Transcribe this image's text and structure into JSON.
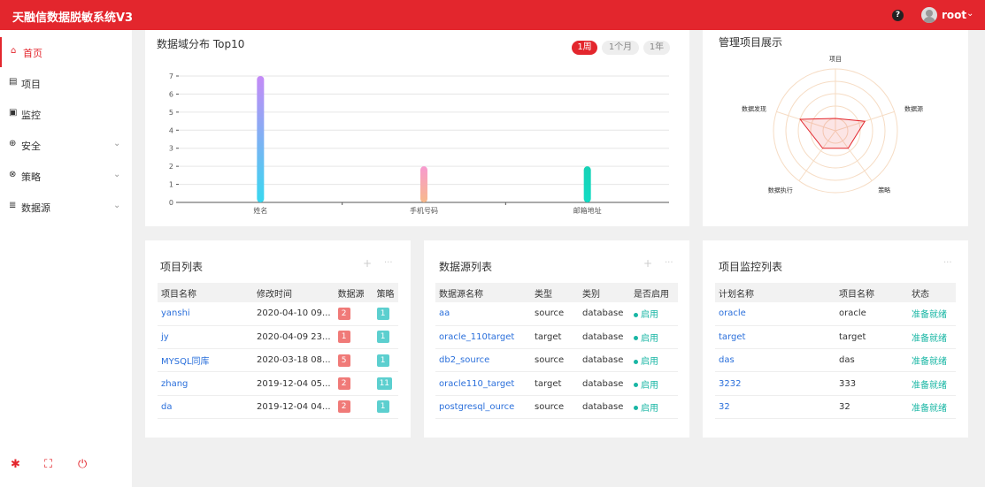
{
  "app": {
    "title": "天融信数据脱敏系统V3",
    "help_icon": "?",
    "user": "root"
  },
  "sidebar": {
    "items": [
      {
        "icon": "⌂",
        "label": "首页"
      },
      {
        "icon": "▤",
        "label": "项目"
      },
      {
        "icon": "▣",
        "label": "监控"
      },
      {
        "icon": "⊕",
        "label": "安全"
      },
      {
        "icon": "⊗",
        "label": "策略"
      },
      {
        "icon": "≣",
        "label": "数据源"
      }
    ]
  },
  "domain_chart": {
    "title": "数据域分布 Top10",
    "periods": [
      "1周",
      "1个月",
      "1年"
    ],
    "chart_data": {
      "type": "bar",
      "categories": [
        "姓名",
        "手机号码",
        "邮箱地址"
      ],
      "values": [
        7,
        2,
        2
      ],
      "ylim": [
        0,
        7
      ],
      "yticks": [
        "0",
        "1",
        "2",
        "3",
        "4",
        "5",
        "6",
        "7"
      ],
      "colors": [
        [
          "#c58af7",
          "#38d8f0"
        ],
        [
          "#f79ad0",
          "#f7b98b"
        ],
        [
          "#16d1b5",
          "#11dcc4"
        ]
      ]
    }
  },
  "radar": {
    "title": "管理项目展示",
    "chart_data": {
      "type": "radar",
      "axes": [
        "项目",
        "数据源",
        "策略",
        "数据执行",
        "数据发现"
      ],
      "values": [
        0.2,
        0.5,
        0.35,
        0.35,
        0.6
      ],
      "color": "#e3262d"
    }
  },
  "project_list": {
    "title": "项目列表",
    "columns": [
      "项目名称",
      "修改时间",
      "数据源",
      "策略"
    ],
    "rows": [
      {
        "name": "yanshi",
        "time": "2020-04-10 09...",
        "src": "2",
        "policy": "1"
      },
      {
        "name": "jy",
        "time": "2020-04-09 23...",
        "src": "1",
        "policy": "1"
      },
      {
        "name": "MYSQL同库",
        "time": "2020-03-18 08...",
        "src": "5",
        "policy": "1"
      },
      {
        "name": "zhang",
        "time": "2019-12-04 05...",
        "src": "2",
        "policy": "11"
      },
      {
        "name": "da",
        "time": "2019-12-04 04...",
        "src": "2",
        "policy": "1"
      }
    ]
  },
  "datasource_list": {
    "title": "数据源列表",
    "columns": [
      "数据源名称",
      "类型",
      "类别",
      "是否启用"
    ],
    "rows": [
      {
        "name": "aa",
        "type": "source",
        "cat": "database",
        "enabled": "启用"
      },
      {
        "name": "oracle_110target",
        "type": "target",
        "cat": "database",
        "enabled": "启用"
      },
      {
        "name": "db2_source",
        "type": "source",
        "cat": "database",
        "enabled": "启用"
      },
      {
        "name": "oracle110_target",
        "type": "target",
        "cat": "database",
        "enabled": "启用"
      },
      {
        "name": "postgresql_ource",
        "type": "source",
        "cat": "database",
        "enabled": "启用"
      }
    ]
  },
  "monitor_list": {
    "title": "项目监控列表",
    "columns": [
      "计划名称",
      "项目名称",
      "状态"
    ],
    "rows": [
      {
        "plan": "oracle",
        "project": "oracle",
        "status": "准备就绪"
      },
      {
        "plan": "target",
        "project": "target",
        "status": "准备就绪"
      },
      {
        "plan": "das",
        "project": "das",
        "status": "准备就绪"
      },
      {
        "plan": "3232",
        "project": "333",
        "status": "准备就绪"
      },
      {
        "plan": "32",
        "project": "32",
        "status": "准备就绪"
      }
    ]
  },
  "tools": {
    "settings_icon": "✱",
    "fullscreen_icon": "⛶",
    "power_icon": "⏻"
  }
}
